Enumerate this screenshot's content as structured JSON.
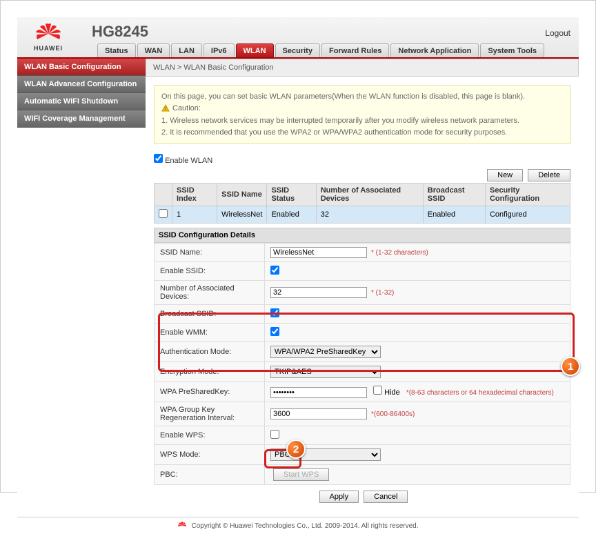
{
  "brand": {
    "name": "HUAWEI",
    "model": "HG8245"
  },
  "header": {
    "logout": "Logout"
  },
  "tabs": [
    "Status",
    "WAN",
    "LAN",
    "IPv6",
    "WLAN",
    "Security",
    "Forward Rules",
    "Network Application",
    "System Tools"
  ],
  "active_tab": "WLAN",
  "sidebar": {
    "items": [
      "WLAN Basic Configuration",
      "WLAN Advanced Configuration",
      "Automatic WIFI Shutdown",
      "WIFI Coverage Management"
    ],
    "active_index": 0
  },
  "breadcrumb": "WLAN > WLAN Basic Configuration",
  "notice": {
    "intro": "On this page, you can set basic WLAN parameters(When the WLAN function is disabled, this page is blank).",
    "caution_label": "Caution:",
    "line1": "1. Wireless network services may be interrupted temporarily after you modify wireless network parameters.",
    "line2": "2. It is recommended that you use the WPA2 or WPA/WPA2 authentication mode for security purposes."
  },
  "enable_wlan": {
    "label": "Enable WLAN",
    "checked": true
  },
  "buttons": {
    "new": "New",
    "delete": "Delete",
    "apply": "Apply",
    "cancel": "Cancel",
    "start_wps": "Start WPS"
  },
  "table": {
    "headers": [
      "",
      "SSID Index",
      "SSID Name",
      "SSID Status",
      "Number of Associated Devices",
      "Broadcast SSID",
      "Security Configuration"
    ],
    "row": {
      "index": "1",
      "name": "WirelessNet",
      "status": "Enabled",
      "devices": "32",
      "broadcast": "Enabled",
      "security": "Configured"
    }
  },
  "details_header": "SSID Configuration Details",
  "form": {
    "ssid_name": {
      "label": "SSID Name:",
      "value": "WirelessNet",
      "hint": "* (1-32 characters)"
    },
    "enable_ssid": {
      "label": "Enable SSID:",
      "checked": true
    },
    "num_devices": {
      "label": "Number of Associated Devices:",
      "value": "32",
      "hint": "* (1-32)"
    },
    "broadcast": {
      "label": "Broadcast SSID:",
      "checked": true
    },
    "wmm": {
      "label": "Enable WMM:",
      "checked": true
    },
    "auth_mode": {
      "label": "Authentication Mode:",
      "value": "WPA/WPA2 PreSharedKey"
    },
    "enc_mode": {
      "label": "Encryption Mode:",
      "value": "TKIP&AES"
    },
    "psk": {
      "label": "WPA PreSharedKey:",
      "value": "••••••••",
      "hide_label": "Hide",
      "hide_checked": false,
      "hint": "*(8-63 characters or 64 hexadecimal characters)"
    },
    "regen": {
      "label": "WPA Group Key Regeneration Interval:",
      "value": "3600",
      "hint": "*(600-86400s)"
    },
    "wps": {
      "label": "Enable WPS:",
      "checked": false
    },
    "wps_mode": {
      "label": "WPS Mode:",
      "value": "PBC"
    },
    "pbc": {
      "label": "PBC:"
    }
  },
  "footer": "Copyright © Huawei Technologies Co., Ltd. 2009-2014. All rights reserved."
}
